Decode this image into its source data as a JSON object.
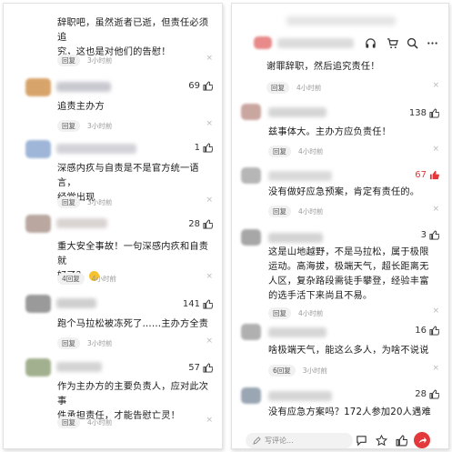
{
  "left_comments": [
    {
      "text_lines": [
        "辞职吧，虽然逝者已逝，但责任必须追",
        "究，这也是对他们的告慰！"
      ],
      "reply": "回复",
      "time": "3小时前",
      "likes": null
    },
    {
      "text_lines": [
        "追责主办方"
      ],
      "reply": "回复",
      "time": "3小时前",
      "likes": "69"
    },
    {
      "text_lines": [
        "深感内疚与自责是不是官方统一语言，",
        "经常出现"
      ],
      "reply": "回复",
      "time": "3小时前",
      "likes": "1"
    },
    {
      "text_lines": [
        "重大安全事故！一句深感内疚和自责就",
        "好了？"
      ],
      "reply": "4回复",
      "time": "4小时前",
      "likes": "28"
    },
    {
      "text_lines": [
        "跑个马拉松被冻死了……主办方全责"
      ],
      "reply": "回复",
      "time": "3小时前",
      "likes": "141"
    },
    {
      "text_lines": [
        "作为主办方的主要负责人，应对此次事",
        "件承担责任，才能告慰亡灵！"
      ],
      "reply": "回复",
      "time": "4小时前",
      "likes": "57"
    }
  ],
  "right_comments": [
    {
      "text_lines": [
        "谢罪辞职，然后追究责任！"
      ],
      "reply": "回复",
      "time": "4小时前",
      "likes": null
    },
    {
      "text_lines": [
        "兹事体大。主办方应负责任！"
      ],
      "reply": "回复",
      "time": "4小时前",
      "likes": "138"
    },
    {
      "text_lines": [
        "没有做好应急预案，肯定有责任的。"
      ],
      "reply": "回复",
      "time": "4小时前",
      "likes": "67"
    },
    {
      "text_lines": [
        "这是山地越野，不是马拉松，属于极限",
        "运动。高海拔，极端天气，超长距离无",
        "人区，复杂路段需徒手攀登，经验丰富",
        "的选手活下来尚且不易。"
      ],
      "reply": "回复",
      "time": "4小时前",
      "likes": "3"
    },
    {
      "text_lines": [
        "啥极端天气，能这么多人，为啥不说说"
      ],
      "reply": "6回复",
      "time": "3小时前",
      "likes": "16"
    },
    {
      "text_lines": [
        "没有应急方案吗？172人参加20人遇难"
      ],
      "reply": "",
      "time": "",
      "likes": "28"
    }
  ],
  "bottom": {
    "write_placeholder": "写评论..."
  },
  "colors": {
    "hot_red": "#e4393c",
    "text": "#1a1a1a",
    "meta": "#999999"
  }
}
